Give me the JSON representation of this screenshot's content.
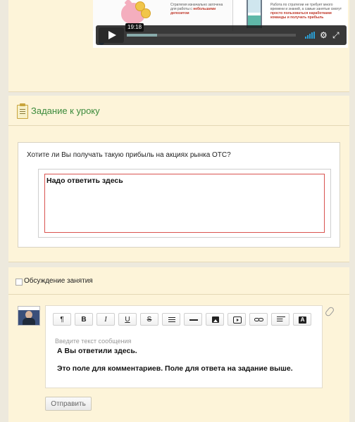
{
  "video": {
    "time_tooltip": "19:18",
    "progress_fraction": 0.18,
    "slide_left_text_1": "Стратегия изначально заточена для работы с",
    "slide_left_text_2": "небольшими депозитом",
    "slide_right_text_1": "Работа по стратегии не требует много времени и знаний, а самые занятые смогут",
    "slide_right_text_2": "просто пользоваться наработками команды и получать прибыль"
  },
  "task": {
    "title": "Задание к уроку",
    "question": "Хотите ли Вы получать такую прибыль на акциях рынка OTC?",
    "answer_text": "Надо ответить здесь"
  },
  "discussion": {
    "title": "Обсуждение занятия",
    "placeholder": "Введите текст сообщения",
    "comment_line_1": "А Вы ответили здесь.",
    "comment_line_2": "Это поле для комментариев. Поле для ответа на задание выше.",
    "send_label": "Отправить",
    "toolbar": {
      "paragraph": "¶",
      "bold": "B",
      "italic": "I",
      "underline": "U",
      "strike": "S",
      "font_letter": "A"
    }
  },
  "colors": {
    "panel_bg": "#fdf4d9",
    "task_title": "#3c8b3c",
    "answer_border": "#d9534f"
  }
}
